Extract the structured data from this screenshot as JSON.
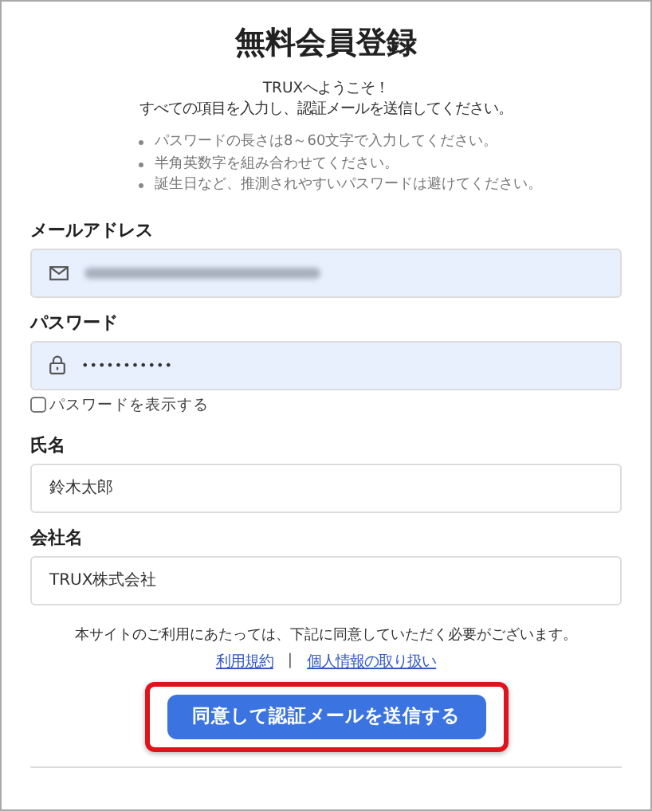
{
  "title": "無料会員登録",
  "intro": [
    "TRUXへようこそ！",
    "すべての項目を入力し、認証メールを送信してください。"
  ],
  "rules": [
    "パスワードの長さは8～60文字で入力してください。",
    "半角英数字を組み合わせてください。",
    "誕生日など、推測されやすいパスワードは避けてください。"
  ],
  "fields": [
    {
      "kind": "email",
      "label": "メールアドレス",
      "value_blurred": true
    },
    {
      "kind": "password",
      "label": "パスワード",
      "value": "•••••••••••"
    },
    {
      "kind": "checkbox",
      "label": "パスワードを表示する",
      "checked": false
    },
    {
      "kind": "text",
      "label": "氏名",
      "value": "鈴木太郎"
    },
    {
      "kind": "text",
      "label": "会社名",
      "value": "TRUX株式会社"
    }
  ],
  "notice": "本サイトのご利用にあたっては、下記に同意していただく必要がございます。",
  "links": [
    "利用規約",
    "個人情報の取り扱い"
  ],
  "link_separator": "|",
  "submit": {
    "label": "同意して認証メールを送信する",
    "highlighted": true
  }
}
